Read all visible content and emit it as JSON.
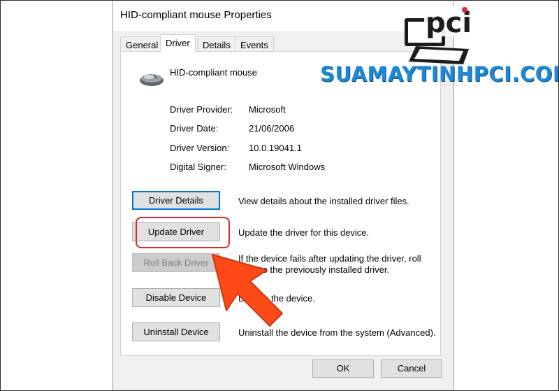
{
  "dialog": {
    "title": "HID-compliant mouse Properties",
    "tabs": [
      {
        "label": "General",
        "active": false
      },
      {
        "label": "Driver",
        "active": true
      },
      {
        "label": "Details",
        "active": false
      },
      {
        "label": "Events",
        "active": false
      }
    ],
    "device_name": "HID-compliant mouse",
    "info": [
      {
        "label": "Driver Provider:",
        "value": "Microsoft"
      },
      {
        "label": "Driver Date:",
        "value": "21/06/2006"
      },
      {
        "label": "Driver Version:",
        "value": "10.0.19041.1"
      },
      {
        "label": "Digital Signer:",
        "value": "Microsoft Windows"
      }
    ],
    "actions": [
      {
        "label": "Driver Details",
        "description": "View details about the installed driver files.",
        "enabled": true
      },
      {
        "label": "Update Driver",
        "description": "Update the driver for this device.",
        "enabled": true
      },
      {
        "label": "Roll Back Driver",
        "description": "If the device fails after updating the driver, roll back to the previously installed driver.",
        "enabled": false
      },
      {
        "label": "Disable Device",
        "description": "Disable the device.",
        "enabled": true
      },
      {
        "label": "Uninstall Device",
        "description": "Uninstall the device from the system (Advanced).",
        "enabled": true
      }
    ],
    "ok_label": "OK",
    "cancel_label": "Cancel"
  },
  "watermark": {
    "logo_text": "pci",
    "brand_text": "SUAMAYTINHPCI.COM",
    "logo_icon": "laptop-icon"
  },
  "colors": {
    "highlight": "#e0262a",
    "arrow": "#ff4a17",
    "brand": "#1e88d6",
    "focus": "#0078d7"
  }
}
